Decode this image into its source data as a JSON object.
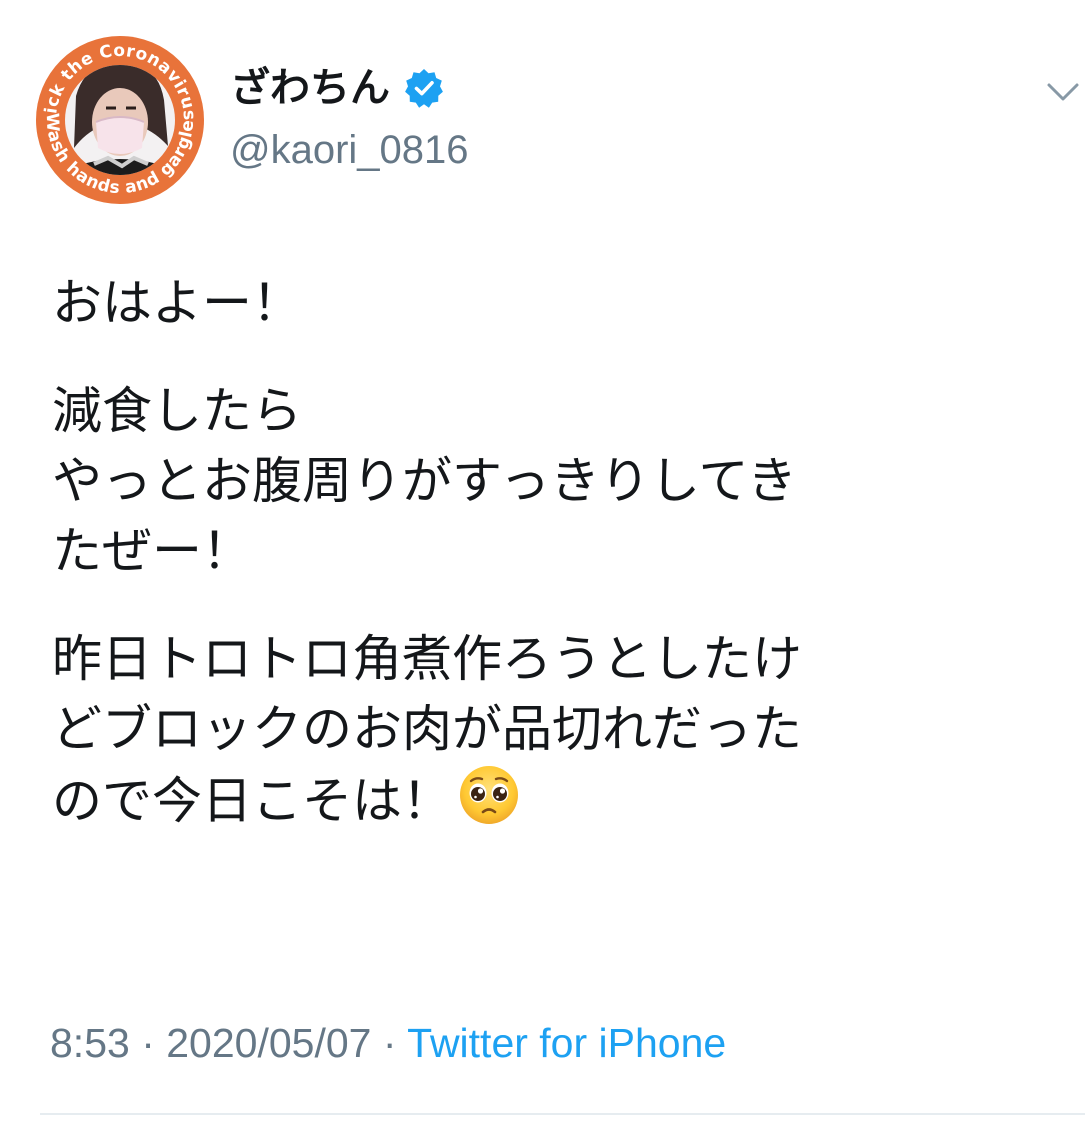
{
  "user": {
    "display_name": "ざわちん",
    "handle": "@kaori_0816",
    "avatar_ring_text_top": "Kick the Coronavirus.",
    "avatar_ring_text_bottom": "Wash hands and gargle.",
    "avatar_ring_color": "#e8733a"
  },
  "tweet": {
    "paragraphs": [
      [
        "おはよー！"
      ],
      [
        "減食したら",
        "やっとお腹周りがすっきりしてき",
        "たぜー！"
      ],
      [
        "昨日トロトロ角煮作ろうとしたけ",
        "どブロックのお肉が品切れだった",
        "ので今日こそは！"
      ]
    ],
    "emoji": "pleading-face"
  },
  "meta": {
    "time": "8:53",
    "separator": " · ",
    "date": "2020/05/07",
    "source": "Twitter for iPhone"
  },
  "colors": {
    "text": "#14171a",
    "secondary": "#657786",
    "link": "#1da1f2",
    "verified": "#1da1f2"
  }
}
